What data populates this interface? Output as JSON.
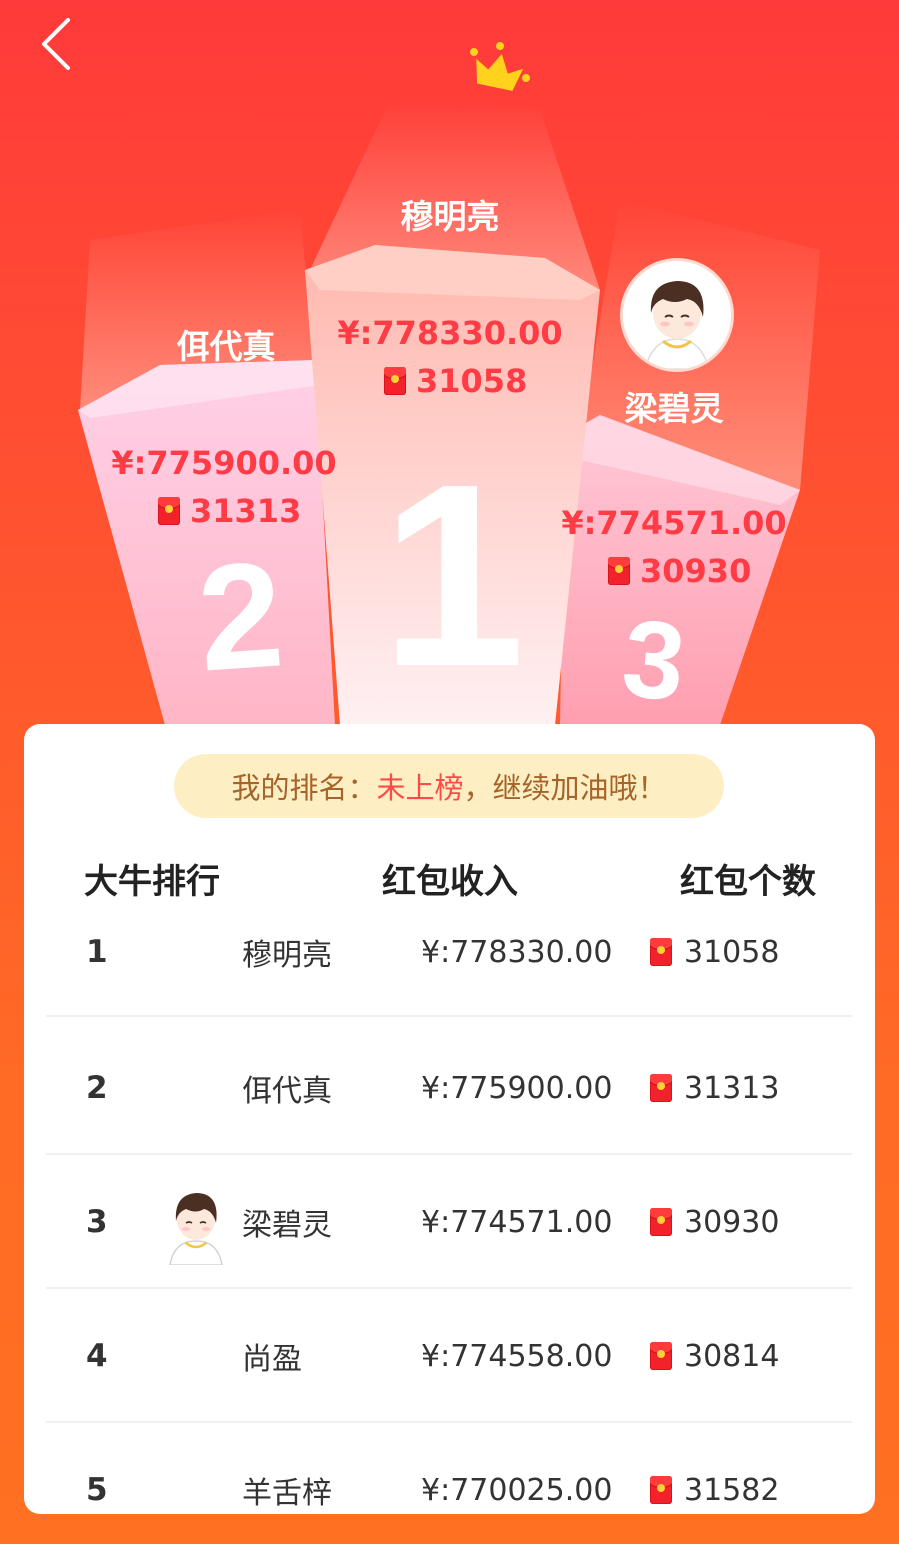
{
  "podium": {
    "first": {
      "rank": "1",
      "name": "穆明亮",
      "money": "¥:778330.00",
      "count": "31058"
    },
    "second": {
      "rank": "2",
      "name": "佴代真",
      "money": "¥:775900.00",
      "count": "31313"
    },
    "third": {
      "rank": "3",
      "name": "梁碧灵",
      "money": "¥:774571.00",
      "count": "30930"
    }
  },
  "my_rank": {
    "label": "我的排名：",
    "status": "未上榜",
    "suffix": "，继续加油哦！"
  },
  "table": {
    "headers": [
      "大牛排行",
      "红包收入",
      "红包个数"
    ],
    "rows": [
      {
        "rank": "1",
        "name": "穆明亮",
        "money": "¥:778330.00",
        "count": "31058",
        "avatar": false
      },
      {
        "rank": "2",
        "name": "佴代真",
        "money": "¥:775900.00",
        "count": "31313",
        "avatar": false
      },
      {
        "rank": "3",
        "name": "梁碧灵",
        "money": "¥:774571.00",
        "count": "30930",
        "avatar": true
      },
      {
        "rank": "4",
        "name": "尚盈",
        "money": "¥:774558.00",
        "count": "30814",
        "avatar": false
      },
      {
        "rank": "5",
        "name": "羊舌梓",
        "money": "¥:770025.00",
        "count": "31582",
        "avatar": false
      }
    ]
  },
  "icons": {
    "back": "chevron-left-icon",
    "crown": "crown-icon",
    "redpack": "red-envelope-icon"
  },
  "colors": {
    "accent": "#ff3b46",
    "bg_top": "#ff3a3a",
    "bg_bottom": "#ff7022",
    "rank_pill": "#fdefc3"
  }
}
